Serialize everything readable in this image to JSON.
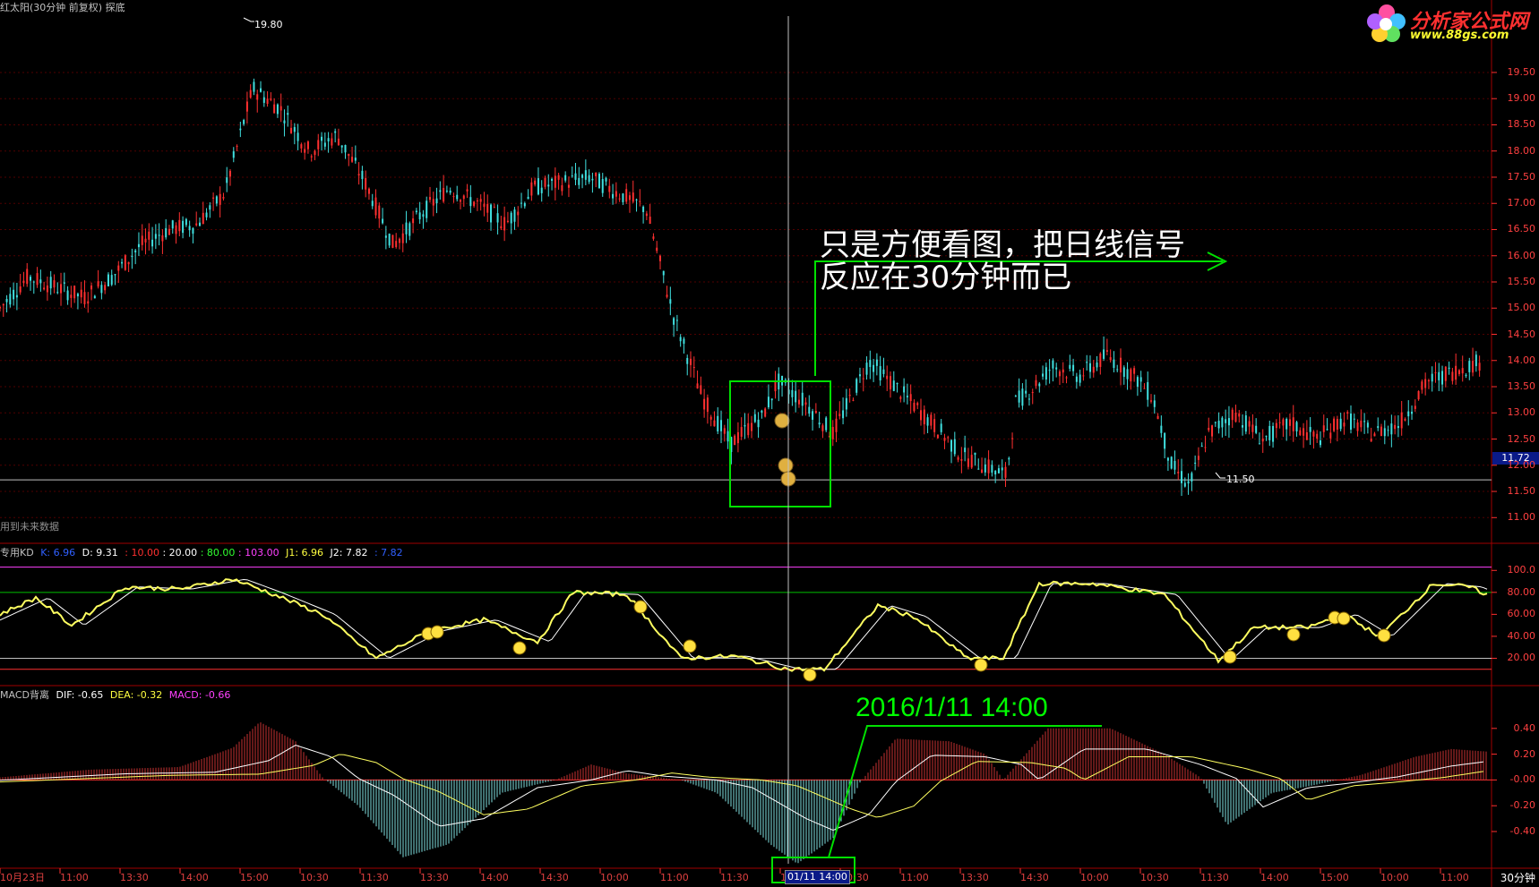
{
  "window": {
    "title": "红太阳(30分钟 前复权) 探底",
    "future_data_note": "用到未来数据",
    "period": "30分钟"
  },
  "logo": {
    "title": "分析家公式网",
    "url": "www.88gs.com",
    "icon": "flower-logo-icon"
  },
  "price_panel": {
    "high_label": "19.80",
    "low_label": "11.50",
    "current_price": "11.72",
    "axis_ticks": [
      "19.50",
      "19.00",
      "18.50",
      "18.00",
      "17.50",
      "17.00",
      "16.50",
      "16.00",
      "15.50",
      "15.00",
      "14.50",
      "14.00",
      "13.50",
      "13.00",
      "12.50",
      "12.00",
      "11.50",
      "11.00"
    ]
  },
  "annotations": {
    "note_line1": "只是方便看图，把日线信号",
    "note_line2": "反应在30分钟而已",
    "date_label": "2016/1/11   14:00"
  },
  "kd_panel": {
    "title": "专用KD",
    "k_label": "K: 6.96",
    "d_label": "D: 9.31",
    "p1": ": 10.00",
    "p2": ": 20.00",
    "p3": ": 80.00",
    "p4": ": 103.00",
    "j1": "J1: 6.96",
    "j2": "J2: 7.82",
    "j3": ": 7.82",
    "axis_ticks": [
      "100.0",
      "80.00",
      "60.00",
      "40.00",
      "20.00"
    ]
  },
  "macd_panel": {
    "title": "MACD背离",
    "dif": "DIF: -0.65",
    "dea": "DEA: -0.32",
    "macd": "MACD: -0.66",
    "axis_ticks": [
      "0.40",
      "0.20",
      "-0.00",
      "-0.20",
      "-0.40"
    ]
  },
  "time_axis": {
    "labels": [
      "10月23日",
      "11:00",
      "13:30",
      "14:00",
      "15:00",
      "10:30",
      "11:30",
      "13:30",
      "14:00",
      "14:30",
      "10:00",
      "11:00",
      "11:30",
      "14:00",
      "10:30",
      "11:00",
      "13:30",
      "14:30",
      "10:00",
      "10:30",
      "11:30",
      "14:00",
      "15:00",
      "10:00",
      "11:00"
    ],
    "cursor_label": "01/11 14:00"
  },
  "colors": {
    "up": "#ff3030",
    "down": "#40e0e0",
    "kd_k": "#ffff60",
    "kd_d": "#ffffff",
    "macd_pos": "#c83232",
    "macd_neg": "#7fe0e0",
    "annotation": "#00ff00"
  },
  "chart_data": [
    {
      "type": "line",
      "title": "红太阳(30分钟 前复权) 探底",
      "ylim": [
        10.8,
        20.2
      ],
      "series": [],
      "x": [
        0,
        20,
        40,
        60,
        80,
        100,
        120,
        140,
        160,
        180,
        200,
        220,
        240,
        260,
        280,
        300,
        320,
        340,
        360,
        380,
        400,
        420,
        440,
        460,
        480,
        500,
        520,
        540
      ],
      "y": [
        15.0,
        15.6,
        15.4,
        15.2,
        15.6,
        16.2,
        16.5,
        16.6,
        17.2,
        19.2,
        18.8,
        18.0,
        18.3,
        17.4,
        16.2,
        16.8,
        17.3,
        17.0,
        16.6,
        17.3,
        17.4,
        17.5,
        17.2,
        16.9,
        14.8,
        13.3,
        12.4,
        12.9
      ]
    },
    {
      "type": "line",
      "title": "专用KD",
      "ylim": [
        0,
        110
      ],
      "series": []
    },
    {
      "type": "bar",
      "title": "MACD背离",
      "ylim": [
        -0.65,
        0.6
      ],
      "series": []
    }
  ]
}
